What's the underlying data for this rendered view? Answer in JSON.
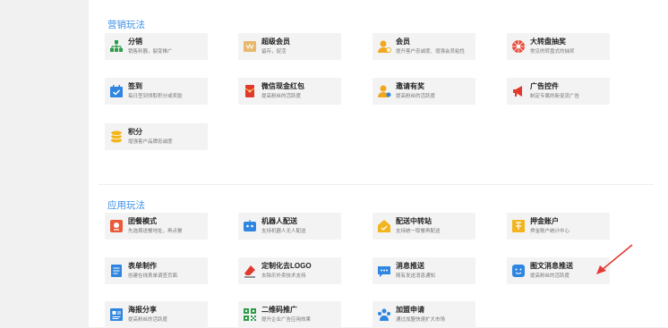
{
  "sections": [
    {
      "title": "营销玩法"
    },
    {
      "title": "应用玩法"
    }
  ],
  "marketing": [
    {
      "name": "分销",
      "desc": "销售利器，裂变推广",
      "icon": "org-chart-icon",
      "color": "#2e9c49"
    },
    {
      "name": "超级会员",
      "desc": "留存，促活",
      "icon": "vip-card-icon",
      "color": "#e8b86d"
    },
    {
      "name": "会员",
      "desc": "提升客户忠诚度、增强会员粘性",
      "icon": "member-icon",
      "color": "#f2a81d"
    },
    {
      "name": "大转盘抽奖",
      "desc": "常见的转盘式的抽奖",
      "icon": "wheel-icon",
      "color": "#e94b3c"
    },
    {
      "name": "签到",
      "desc": "每日签到领取积分或奖励",
      "icon": "calendar-check-icon",
      "color": "#2f86e0"
    },
    {
      "name": "微信现金红包",
      "desc": "提高粉丝的活跃度",
      "icon": "red-packet-icon",
      "color": "#e0392e"
    },
    {
      "name": "邀请有奖",
      "desc": "提高粉丝的活跃度",
      "icon": "invite-icon",
      "color": "#f2a81d"
    },
    {
      "name": "广告控件",
      "desc": "制定专属的新促流广告",
      "icon": "megaphone-icon",
      "color": "#e0392e"
    },
    {
      "name": "积分",
      "desc": "增强客户品牌忠诚度",
      "icon": "coins-icon",
      "color": "#f2b51d"
    }
  ],
  "apps": [
    {
      "name": "团餐模式",
      "desc": "先选择送餐地址，再点餐",
      "icon": "location-icon",
      "color": "#e95a3a"
    },
    {
      "name": "机器人配送",
      "desc": "支持机器人无人配送",
      "icon": "robot-icon",
      "color": "#2f86e0"
    },
    {
      "name": "配送中转站",
      "desc": "支持统一取餐再配送",
      "icon": "home-station-icon",
      "color": "#f2b51d"
    },
    {
      "name": "押金账户",
      "desc": "押金账户统计中心",
      "icon": "deposit-icon",
      "color": "#f2b51d"
    },
    {
      "name": "表单制作",
      "desc": "创建在线表单调查页面",
      "icon": "form-icon",
      "color": "#2f86e0"
    },
    {
      "name": "定制化去LOGO",
      "desc": "去除乐外卖技术支持",
      "icon": "eraser-icon",
      "color": "#e0392e"
    },
    {
      "name": "消息推送",
      "desc": "随有发送消息通知",
      "icon": "message-icon",
      "color": "#2f86e0"
    },
    {
      "name": "图文消息推送",
      "desc": "提高粉丝的活跃度",
      "icon": "smile-chat-icon",
      "color": "#2f86e0"
    },
    {
      "name": "海报分享",
      "desc": "提高粉丝的活跃度",
      "icon": "poster-icon",
      "color": "#2f86e0"
    },
    {
      "name": "二维码推广",
      "desc": "提升企业广告应用效果",
      "icon": "qrcode-icon",
      "color": "#2e9c49"
    },
    {
      "name": "加盟申请",
      "desc": "通过加盟快速扩大市场",
      "icon": "join-icon",
      "color": "#2f86e0"
    }
  ],
  "annotation": {
    "arrow_color": "#e53935"
  }
}
